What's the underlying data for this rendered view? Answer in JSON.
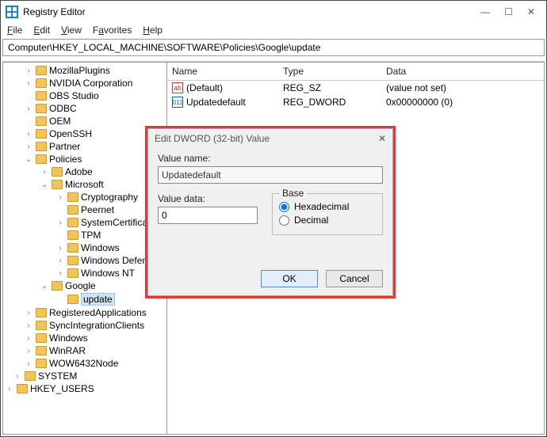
{
  "window": {
    "title": "Registry Editor",
    "min": "—",
    "max": "☐",
    "close": "✕"
  },
  "menu": {
    "file": "File",
    "edit": "Edit",
    "view": "View",
    "favorites": "Favorites",
    "help": "Help"
  },
  "path": "Computer\\HKEY_LOCAL_MACHINE\\SOFTWARE\\Policies\\Google\\update",
  "cols": {
    "name": "Name",
    "type": "Type",
    "data": "Data"
  },
  "rows": [
    {
      "name": "(Default)",
      "type": "REG_SZ",
      "data": "(value not set)",
      "icon": "str"
    },
    {
      "name": "Updatedefault",
      "type": "REG_DWORD",
      "data": "0x00000000 (0)",
      "icon": "dw"
    }
  ],
  "tree": {
    "items": [
      {
        "lvl": 1,
        "tw": ">",
        "label": "MozillaPlugins"
      },
      {
        "lvl": 1,
        "tw": ">",
        "label": "NVIDIA Corporation"
      },
      {
        "lvl": 1,
        "tw": "",
        "label": "OBS Studio"
      },
      {
        "lvl": 1,
        "tw": ">",
        "label": "ODBC"
      },
      {
        "lvl": 1,
        "tw": "",
        "label": "OEM"
      },
      {
        "lvl": 1,
        "tw": ">",
        "label": "OpenSSH"
      },
      {
        "lvl": 1,
        "tw": ">",
        "label": "Partner"
      },
      {
        "lvl": 1,
        "tw": "v",
        "label": "Policies"
      },
      {
        "lvl": 2,
        "tw": ">",
        "label": "Adobe"
      },
      {
        "lvl": 2,
        "tw": "v",
        "label": "Microsoft"
      },
      {
        "lvl": 3,
        "tw": ">",
        "label": "Cryptography"
      },
      {
        "lvl": 3,
        "tw": "",
        "label": "Peernet"
      },
      {
        "lvl": 3,
        "tw": ">",
        "label": "SystemCertificates"
      },
      {
        "lvl": 3,
        "tw": "",
        "label": "TPM"
      },
      {
        "lvl": 3,
        "tw": ">",
        "label": "Windows"
      },
      {
        "lvl": 3,
        "tw": ">",
        "label": "Windows Defender"
      },
      {
        "lvl": 3,
        "tw": ">",
        "label": "Windows NT"
      },
      {
        "lvl": 2,
        "tw": "v",
        "label": "Google"
      },
      {
        "lvl": 3,
        "tw": "",
        "label": "update",
        "sel": true
      },
      {
        "lvl": 1,
        "tw": ">",
        "label": "RegisteredApplications"
      },
      {
        "lvl": 1,
        "tw": ">",
        "label": "SyncIntegrationClients"
      },
      {
        "lvl": 1,
        "tw": ">",
        "label": "Windows"
      },
      {
        "lvl": 1,
        "tw": ">",
        "label": "WinRAR"
      },
      {
        "lvl": 1,
        "tw": ">",
        "label": "WOW6432Node"
      },
      {
        "lvl": 1,
        "tw": ">",
        "label": "SYSTEM",
        "outer": true
      },
      {
        "lvl": 1,
        "tw": ">",
        "label": "HKEY_USERS",
        "outer2": true
      }
    ]
  },
  "dialog": {
    "title": "Edit DWORD (32-bit) Value",
    "value_name_label": "Value name:",
    "value_name": "Updatedefault",
    "value_data_label": "Value data:",
    "value_data": "0",
    "base_label": "Base",
    "hex": "Hexadecimal",
    "dec": "Decimal",
    "ok": "OK",
    "cancel": "Cancel",
    "close": "✕"
  }
}
